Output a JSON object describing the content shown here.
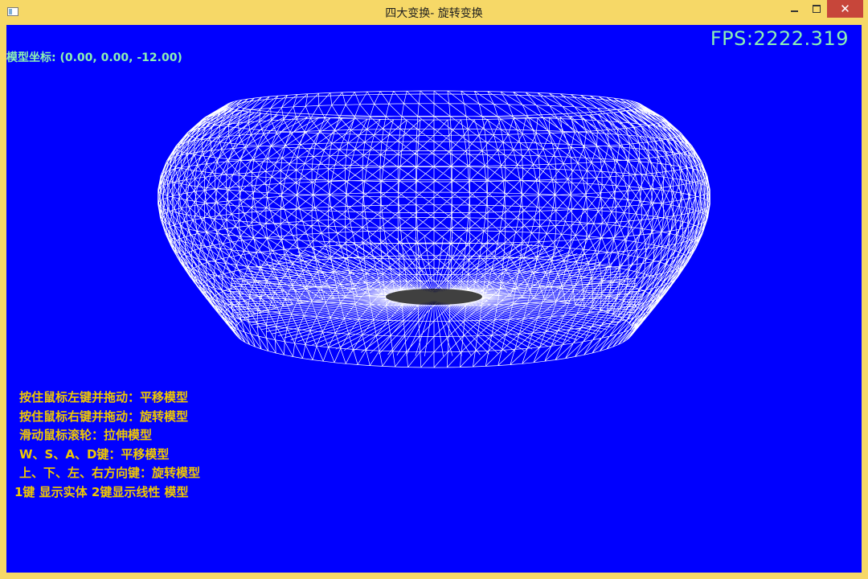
{
  "window": {
    "title": "四大变换- 旋转变换",
    "controls": {
      "minimize": "minimize",
      "maximize": "maximize",
      "close": "✕"
    }
  },
  "hud": {
    "coord_text": "模型坐标: (0.00, 0.00, -12.00)",
    "fps_text": "FPS:2222.319"
  },
  "help": {
    "lines": [
      "按住鼠标左键并拖动：平移模型",
      "按住鼠标右键并拖动：旋转模型",
      "滑动鼠标滚轮：拉伸模型",
      "W、S、A、D键：平移模型",
      " 上、下、左、右方向键：旋转模型",
      "1键 显示实体  2键显示线性 模型"
    ]
  },
  "colors": {
    "viewport_bg": "#0000ff",
    "frame": "#f6d867",
    "wire": "#ffffff",
    "hud_text": "#8cf0b4",
    "help_text": "#f0c800",
    "close_bg": "#c7463a"
  },
  "scene": {
    "model": "wireframe-bowl",
    "render_mode": "wireframe"
  }
}
